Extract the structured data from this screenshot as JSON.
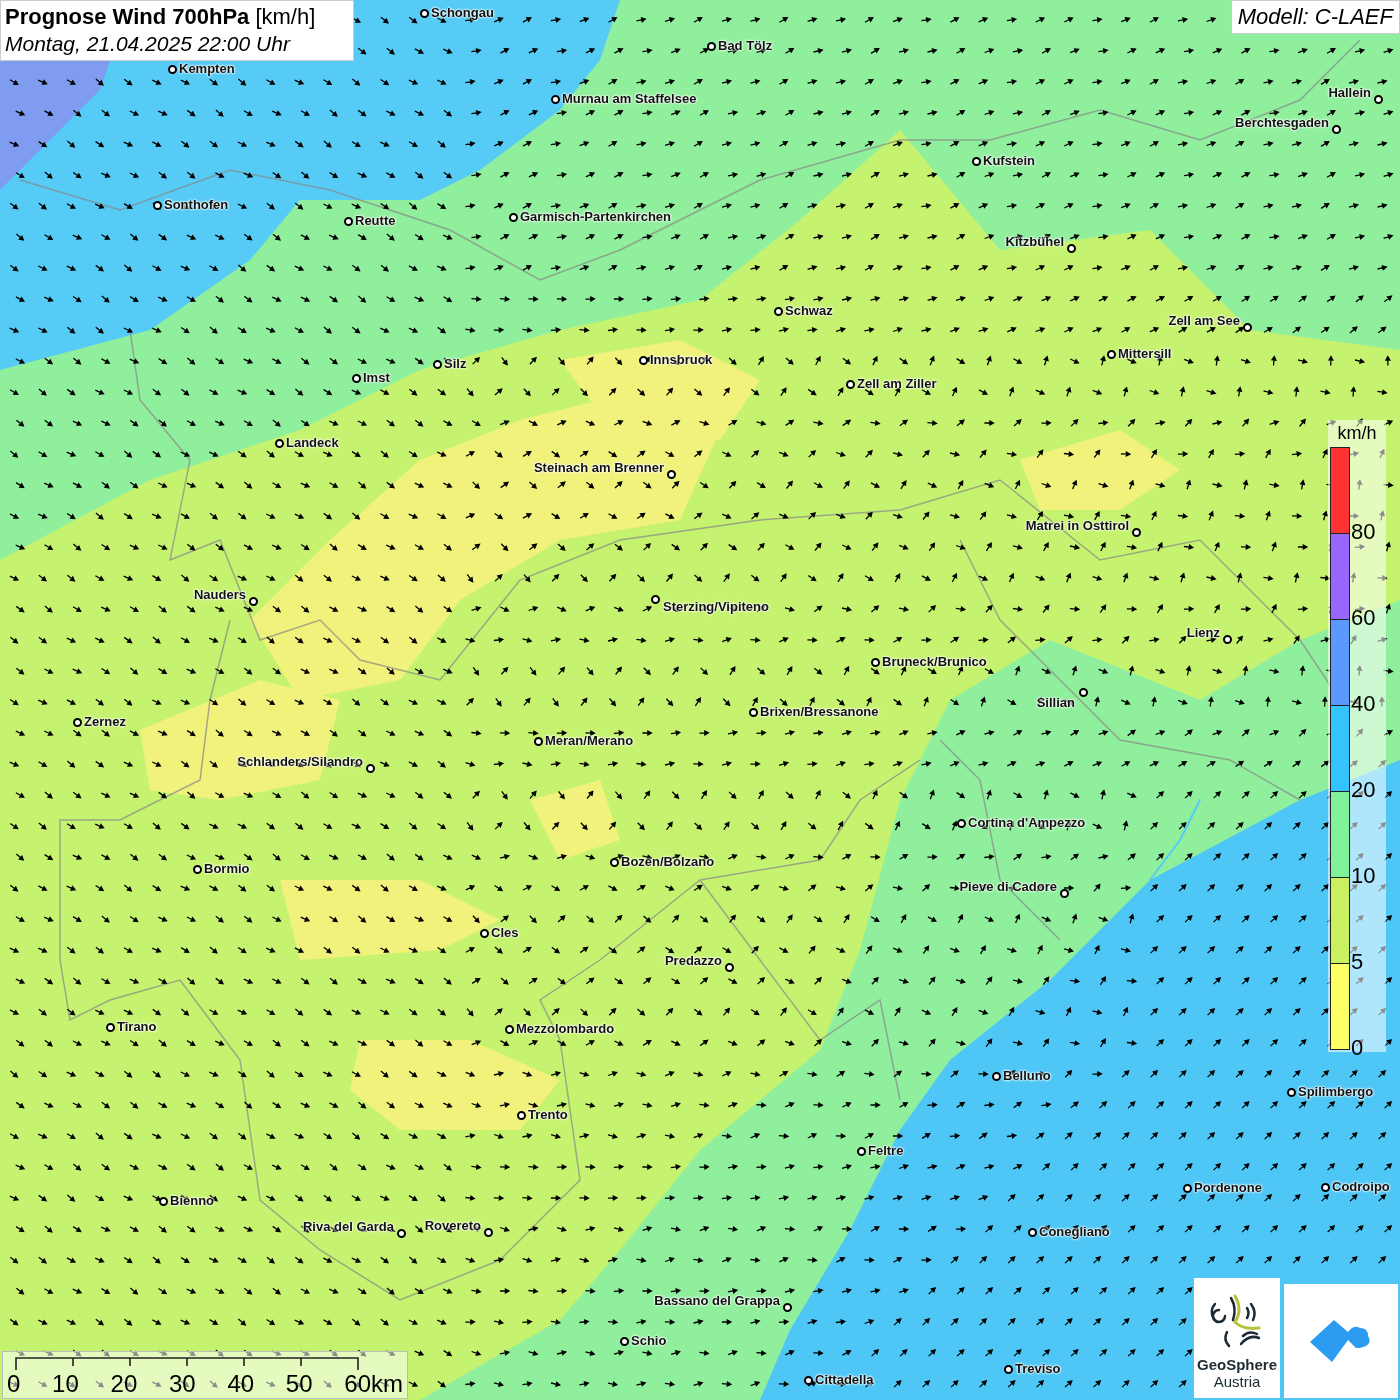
{
  "title": {
    "heading": "Prognose Wind 700hPa",
    "unit": "[km/h]",
    "date": "Montag, 21.04.2025 22:00 Uhr"
  },
  "model": "Modell: C-LAEF",
  "cities": [
    "Schongau",
    "Bad Tölz",
    "Kempten",
    "Hallein",
    "Murnau am Staffelsee",
    "Berchtesgaden",
    "Kufstein",
    "Sonthofen",
    "Reutte",
    "Garmisch-Partenkirchen",
    "Kitzbühel",
    "Schwaz",
    "Zell am See",
    "Mittersill",
    "Innsbruck",
    "Silz",
    "Imst",
    "Zell am Ziller",
    "Landeck",
    "Steinach am Brenner",
    "Matrei in Osttirol",
    "Nauders",
    "Sterzing/Vipiteno",
    "Lienz",
    "Bruneck/Brunico",
    "Sillian",
    "Brixen/Bressanone",
    "Zernez",
    "Meran/Merano",
    "Schlanders/Silandro",
    "Cortina d'Ampezzo",
    "Bozen/Bolzano",
    "Bormio",
    "Pieve di Cadore",
    "Cles",
    "Predazzo",
    "Tirano",
    "Mezzolombardo",
    "Belluno",
    "Spilimbergo",
    "Trento",
    "Feltre",
    "Pordenone",
    "Codroipo",
    "Bienno",
    "Riva del Garda",
    "Rovereto",
    "Conegliano",
    "Bassano del Grappa",
    "Schio",
    "Treviso",
    "Cittadella"
  ],
  "legend": {
    "unit": "km/h",
    "bands": [
      {
        "label": "80",
        "color": "#ff3333"
      },
      {
        "label": "60",
        "color": "#9966ff"
      },
      {
        "label": "40",
        "color": "#5c99ff"
      },
      {
        "label": "20",
        "color": "#33c3ff"
      },
      {
        "label": "10",
        "color": "#80f29a"
      },
      {
        "label": "5",
        "color": "#c8f060"
      },
      {
        "label": "0",
        "color": "#ffff66"
      }
    ]
  },
  "scale_bar": {
    "ticks": [
      "0",
      "10",
      "20",
      "30",
      "40",
      "50",
      "60km"
    ]
  },
  "logo": {
    "line_1": "GeoSphere",
    "line_2": "Austria"
  }
}
